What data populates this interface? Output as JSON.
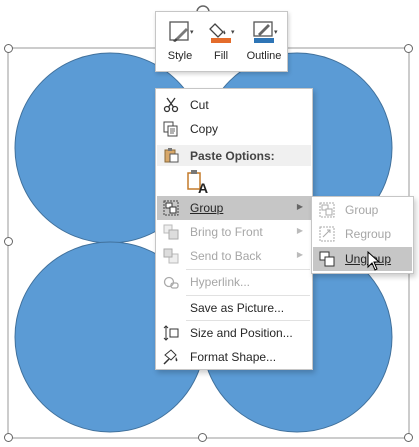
{
  "mini_toolbar": {
    "style_label": "Style",
    "fill_label": "Fill",
    "outline_label": "Outline"
  },
  "colors": {
    "shape_fill": "#5b9bd5",
    "shape_stroke": "#41719c",
    "menu_highlight": "#c6c6c6",
    "fill_accent": "#e46c2b",
    "outline_accent": "#2e75b6"
  },
  "context_menu": {
    "cut": "Cut",
    "copy": "Copy",
    "paste_options": "Paste Options:",
    "group": "Group",
    "bring_to_front": "Bring to Front",
    "send_to_back": "Send to Back",
    "hyperlink": "Hyperlink...",
    "save_as_picture": "Save as Picture...",
    "size_and_position": "Size and Position...",
    "format_shape": "Format Shape..."
  },
  "group_submenu": {
    "group": "Group",
    "regroup": "Regroup",
    "ungroup": "Ungroup"
  }
}
